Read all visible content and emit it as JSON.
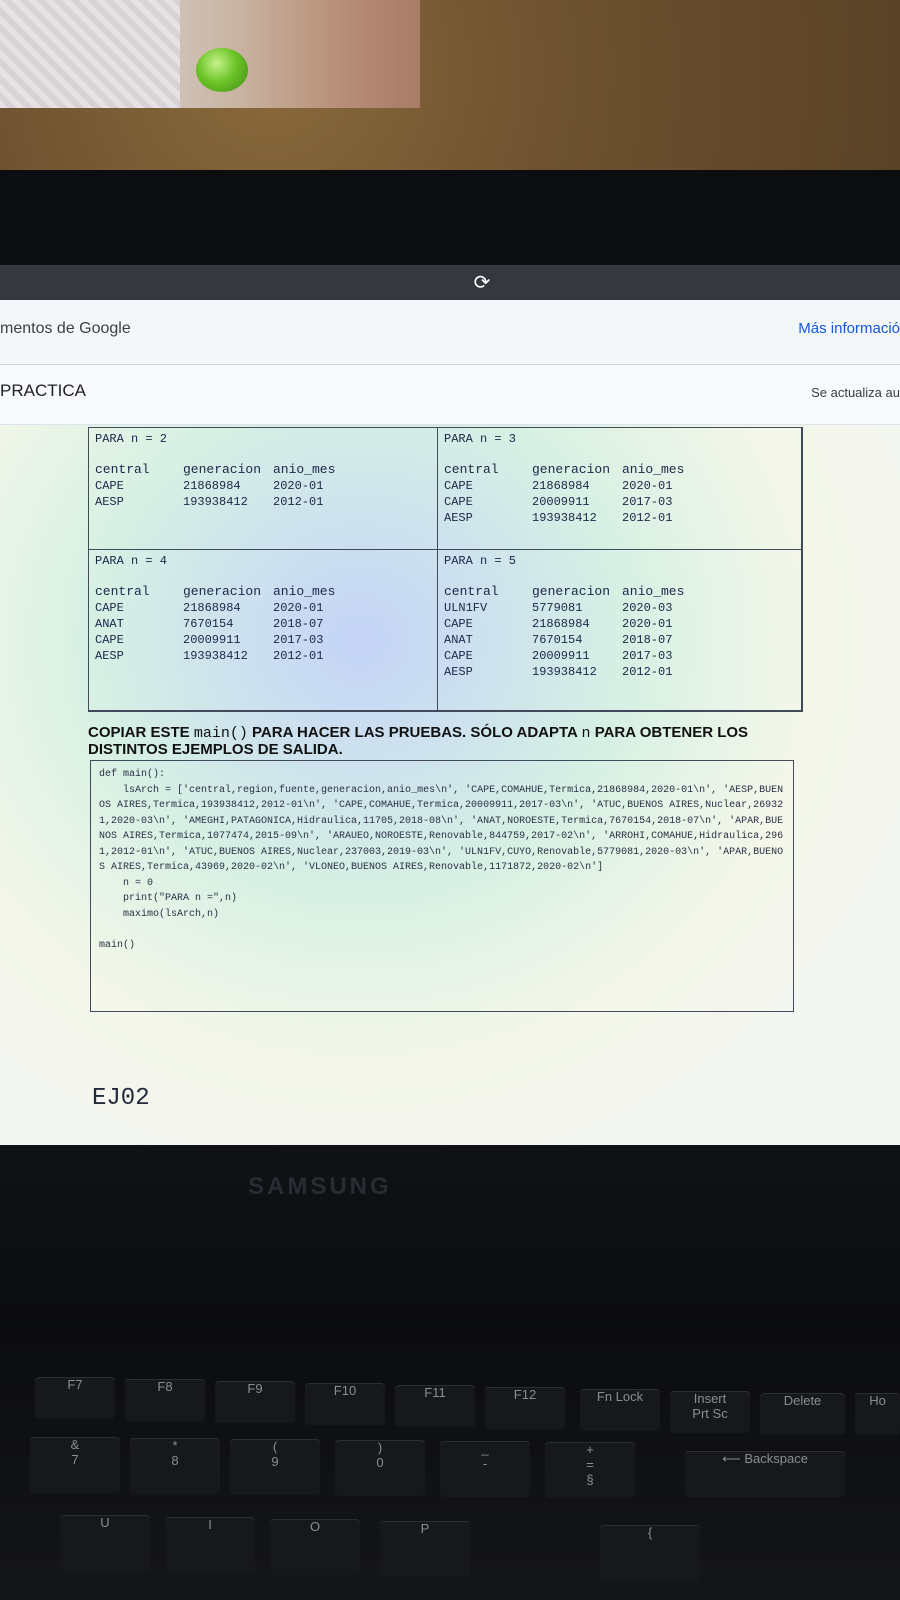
{
  "browser": {
    "reload_icon": "reload-icon",
    "google_bar_left": "mentos de Google",
    "google_bar_right": "Más informació",
    "doc_title": "PRACTICA",
    "doc_update": "Se actualiza au"
  },
  "tables": [
    {
      "header": "PARA n = 2",
      "columns": [
        "central",
        "generacion",
        "anio_mes"
      ],
      "rows": [
        [
          "CAPE",
          "21868984",
          "2020-01"
        ],
        [
          "AESP",
          "193938412",
          "2012-01"
        ]
      ]
    },
    {
      "header": "PARA n = 3",
      "columns": [
        "central",
        "generacion",
        "anio_mes"
      ],
      "rows": [
        [
          "CAPE",
          "21868984",
          "2020-01"
        ],
        [
          "CAPE",
          "20009911",
          "2017-03"
        ],
        [
          "AESP",
          "193938412",
          "2012-01"
        ]
      ]
    },
    {
      "header": "PARA n = 4",
      "columns": [
        "central",
        "generacion",
        "anio_mes"
      ],
      "rows": [
        [
          "CAPE",
          "21868984",
          "2020-01"
        ],
        [
          "ANAT",
          "7670154",
          "2018-07"
        ],
        [
          "CAPE",
          "20009911",
          "2017-03"
        ],
        [
          "AESP",
          "193938412",
          "2012-01"
        ]
      ]
    },
    {
      "header": "PARA n = 5",
      "columns": [
        "central",
        "generacion",
        "anio_mes"
      ],
      "rows": [
        [
          "ULN1FV",
          "5779081",
          "2020-03"
        ],
        [
          "CAPE",
          "21868984",
          "2020-01"
        ],
        [
          "ANAT",
          "7670154",
          "2018-07"
        ],
        [
          "CAPE",
          "20009911",
          "2017-03"
        ],
        [
          "AESP",
          "193938412",
          "2012-01"
        ]
      ]
    }
  ],
  "instructions": {
    "part1": "COPIAR ESTE ",
    "code1": "main()",
    "part2": " PARA HACER LAS PRUEBAS. SÓLO ADAPTA ",
    "code2": "n",
    "part3": " PARA OBTENER LOS DISTINTOS EJEMPLOS DE SALIDA."
  },
  "code": "def main():\n    lsArch = ['central,region,fuente,generacion,anio_mes\\n', 'CAPE,COMAHUE,Termica,21868984,2020-01\\n', 'AESP,BUENOS AIRES,Termica,193938412,2012-01\\n', 'CAPE,COMAHUE,Termica,20009911,2017-03\\n', 'ATUC,BUENOS AIRES,Nuclear,269321,2020-03\\n', 'AMEGHI,PATAGONICA,Hidraulica,11705,2018-08\\n', 'ANAT,NOROESTE,Termica,7670154,2018-07\\n', 'APAR,BUENOS AIRES,Termica,1077474,2015-09\\n', 'ARAUEO,NOROESTE,Renovable,844759,2017-02\\n', 'ARROHI,COMAHUE,Hidraulica,2961,2012-01\\n', 'ATUC,BUENOS AIRES,Nuclear,237003,2019-03\\n', 'ULN1FV,CUYO,Renovable,5779081,2020-03\\n', 'APAR,BUENOS AIRES,Termica,43969,2020-02\\n', 'VLONEO,BUENOS AIRES,Renovable,1171872,2020-02\\n']\n    n = 0\n    print(\"PARA n =\",n)\n    maximo(lsArch,n)\n\nmain()",
  "section_label": "EJ02",
  "keyboard": {
    "brand": "SAMSUNG",
    "fkeys": [
      "F7",
      "F8",
      "F9",
      "F10",
      "F11",
      "F12"
    ],
    "fn_lock": "Fn Lock",
    "insert": "Insert",
    "prtsc": "Prt Sc",
    "delete": "Delete",
    "home": "Ho",
    "row2": [
      [
        "&",
        "7"
      ],
      [
        "*",
        "8"
      ],
      [
        "(",
        "9"
      ],
      [
        ")",
        "0"
      ],
      [
        "_",
        "-"
      ],
      [
        "+",
        "="
      ]
    ],
    "section_mark": "§",
    "backspace": "⟵ Backspace",
    "row3": [
      "U",
      "I",
      "O",
      "P",
      "{"
    ]
  }
}
